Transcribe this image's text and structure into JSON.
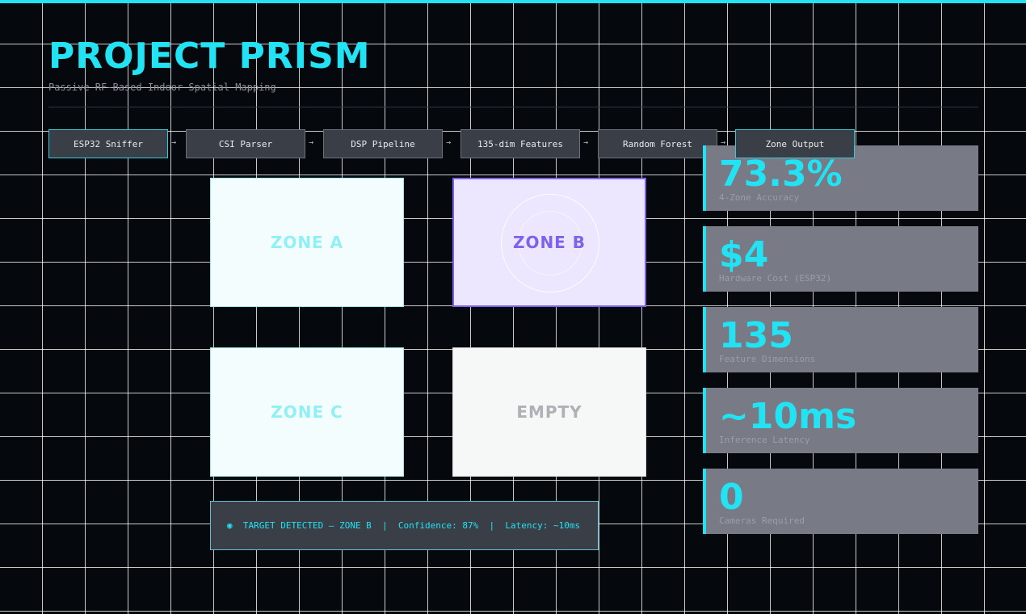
{
  "header": {
    "title": "PROJECT PRISM",
    "subtitle": "Passive RF-Based Indoor Spatial Mapping"
  },
  "pipeline": {
    "steps": [
      "ESP32 Sniffer",
      "CSI Parser",
      "DSP Pipeline",
      "135-dim Features",
      "Random Forest",
      "Zone Output"
    ],
    "arrow": "→"
  },
  "zones": [
    {
      "label": "ZONE A",
      "state": "idle"
    },
    {
      "label": "ZONE B",
      "state": "active"
    },
    {
      "label": "ZONE C",
      "state": "idle"
    },
    {
      "label": "EMPTY",
      "state": "empty"
    }
  ],
  "status": {
    "text": "◉  TARGET DETECTED — ZONE B  |  Confidence: 87%  |  Latency: ~10ms"
  },
  "stats": [
    {
      "value": "73.3%",
      "label": "4-Zone Accuracy"
    },
    {
      "value": "$4",
      "label": "Hardware Cost (ESP32)"
    },
    {
      "value": "135",
      "label": "Feature Dimensions"
    },
    {
      "value": "~10ms",
      "label": "Inference Latency"
    },
    {
      "value": "0",
      "label": "Cameras Required"
    }
  ],
  "colors": {
    "accent": "#22e3f3",
    "active_zone": "#7c63ea",
    "background": "#05080d"
  }
}
